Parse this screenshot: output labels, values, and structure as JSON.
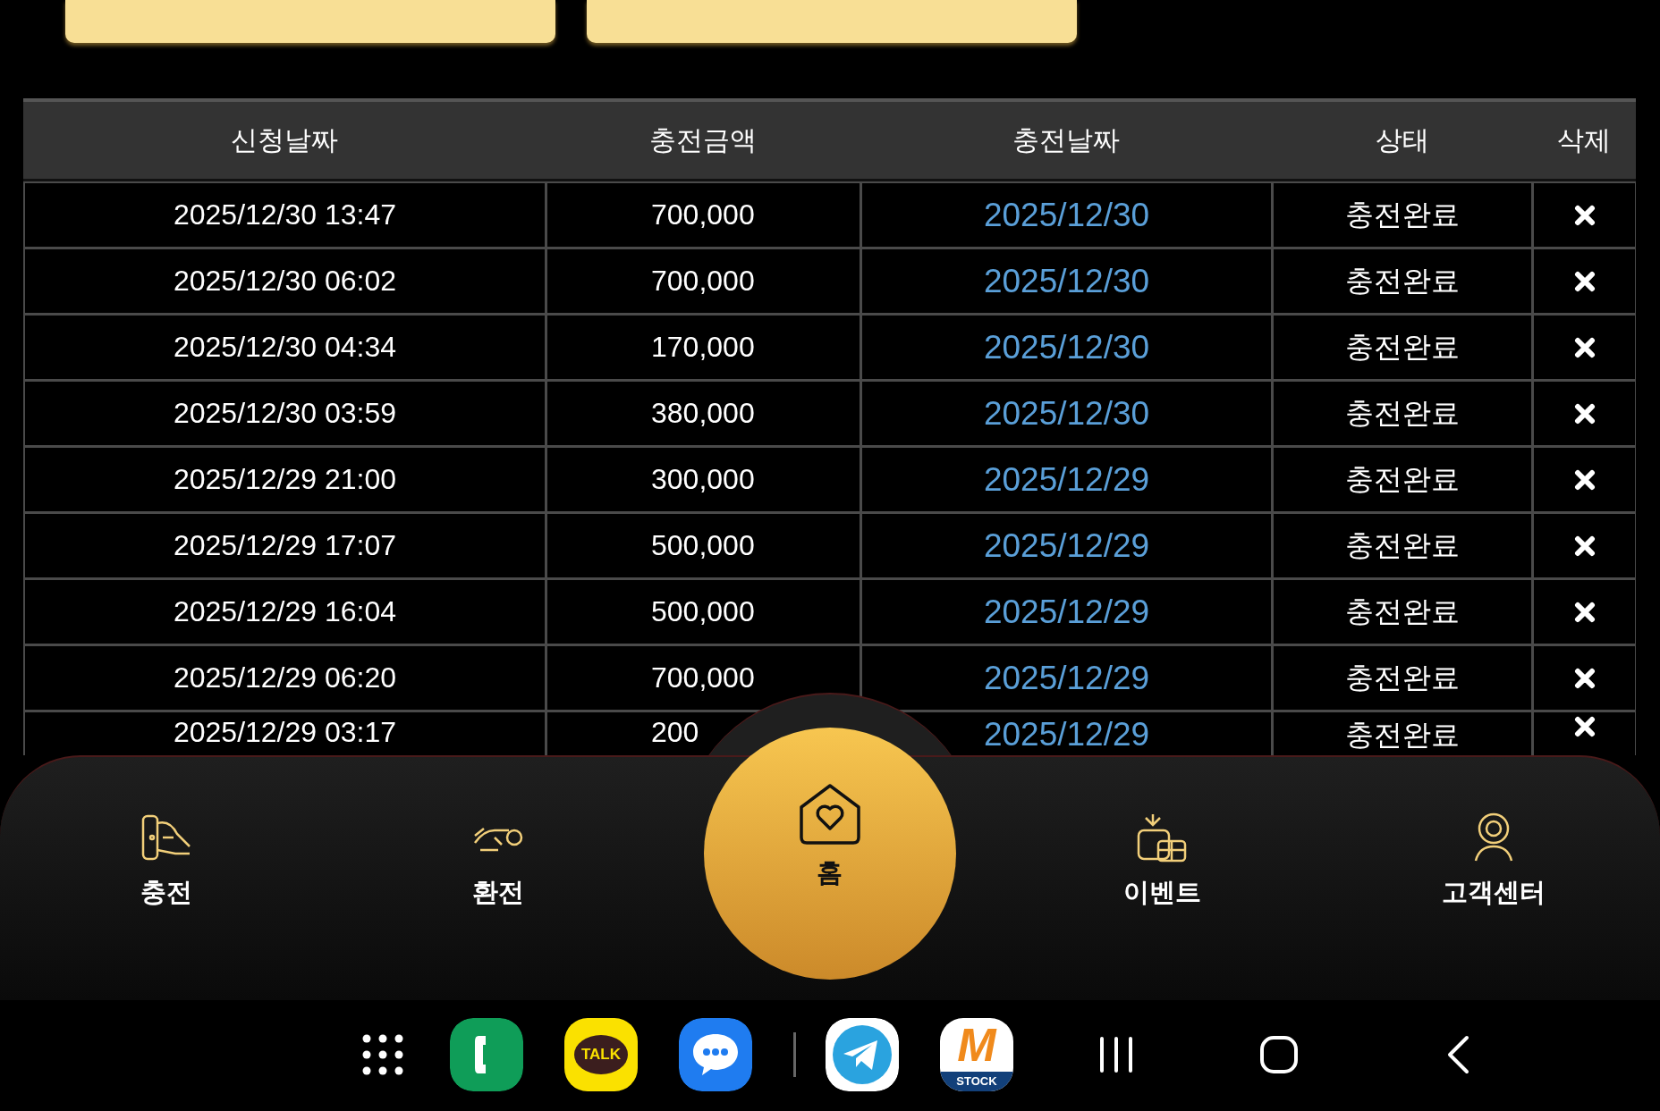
{
  "top_buttons": [
    {
      "kind": "button"
    },
    {
      "kind": "button"
    }
  ],
  "table": {
    "columns": [
      "신청날짜",
      "충전금액",
      "충전날짜",
      "상태",
      "삭제"
    ],
    "rows": [
      {
        "requested": "2025/12/30 13:47",
        "amount": "700,000",
        "charged": "2025/12/30",
        "status": "충전완료"
      },
      {
        "requested": "2025/12/30 06:02",
        "amount": "700,000",
        "charged": "2025/12/30",
        "status": "충전완료"
      },
      {
        "requested": "2025/12/30 04:34",
        "amount": "170,000",
        "charged": "2025/12/30",
        "status": "충전완료"
      },
      {
        "requested": "2025/12/30 03:59",
        "amount": "380,000",
        "charged": "2025/12/30",
        "status": "충전완료"
      },
      {
        "requested": "2025/12/29 21:00",
        "amount": "300,000",
        "charged": "2025/12/29",
        "status": "충전완료"
      },
      {
        "requested": "2025/12/29 17:07",
        "amount": "500,000",
        "charged": "2025/12/29",
        "status": "충전완료"
      },
      {
        "requested": "2025/12/29 16:04",
        "amount": "500,000",
        "charged": "2025/12/29",
        "status": "충전완료"
      },
      {
        "requested": "2025/12/29 06:20",
        "amount": "700,000",
        "charged": "2025/12/29",
        "status": "충전완료"
      },
      {
        "requested": "2025/12/29 03:17",
        "amount": "200",
        "charged": "2025/12/29",
        "status": "충전완료"
      }
    ]
  },
  "bottom_nav": [
    {
      "label": "충전",
      "kind": "charge",
      "selected": false
    },
    {
      "label": "환전",
      "kind": "exchange",
      "selected": false
    },
    {
      "label": "홈",
      "kind": "home",
      "selected": true
    },
    {
      "label": "이벤트",
      "kind": "event",
      "selected": false
    },
    {
      "label": "고객센터",
      "kind": "support",
      "selected": false
    }
  ],
  "dock": [
    {
      "kind": "apps"
    },
    {
      "kind": "phone"
    },
    {
      "kind": "talk",
      "text": "TALK"
    },
    {
      "kind": "chat"
    },
    {
      "kind": "divider"
    },
    {
      "kind": "telegram"
    },
    {
      "kind": "stock",
      "text": "M",
      "subtext": "STOCK"
    },
    {
      "kind": "recents"
    },
    {
      "kind": "home"
    },
    {
      "kind": "back"
    }
  ]
}
